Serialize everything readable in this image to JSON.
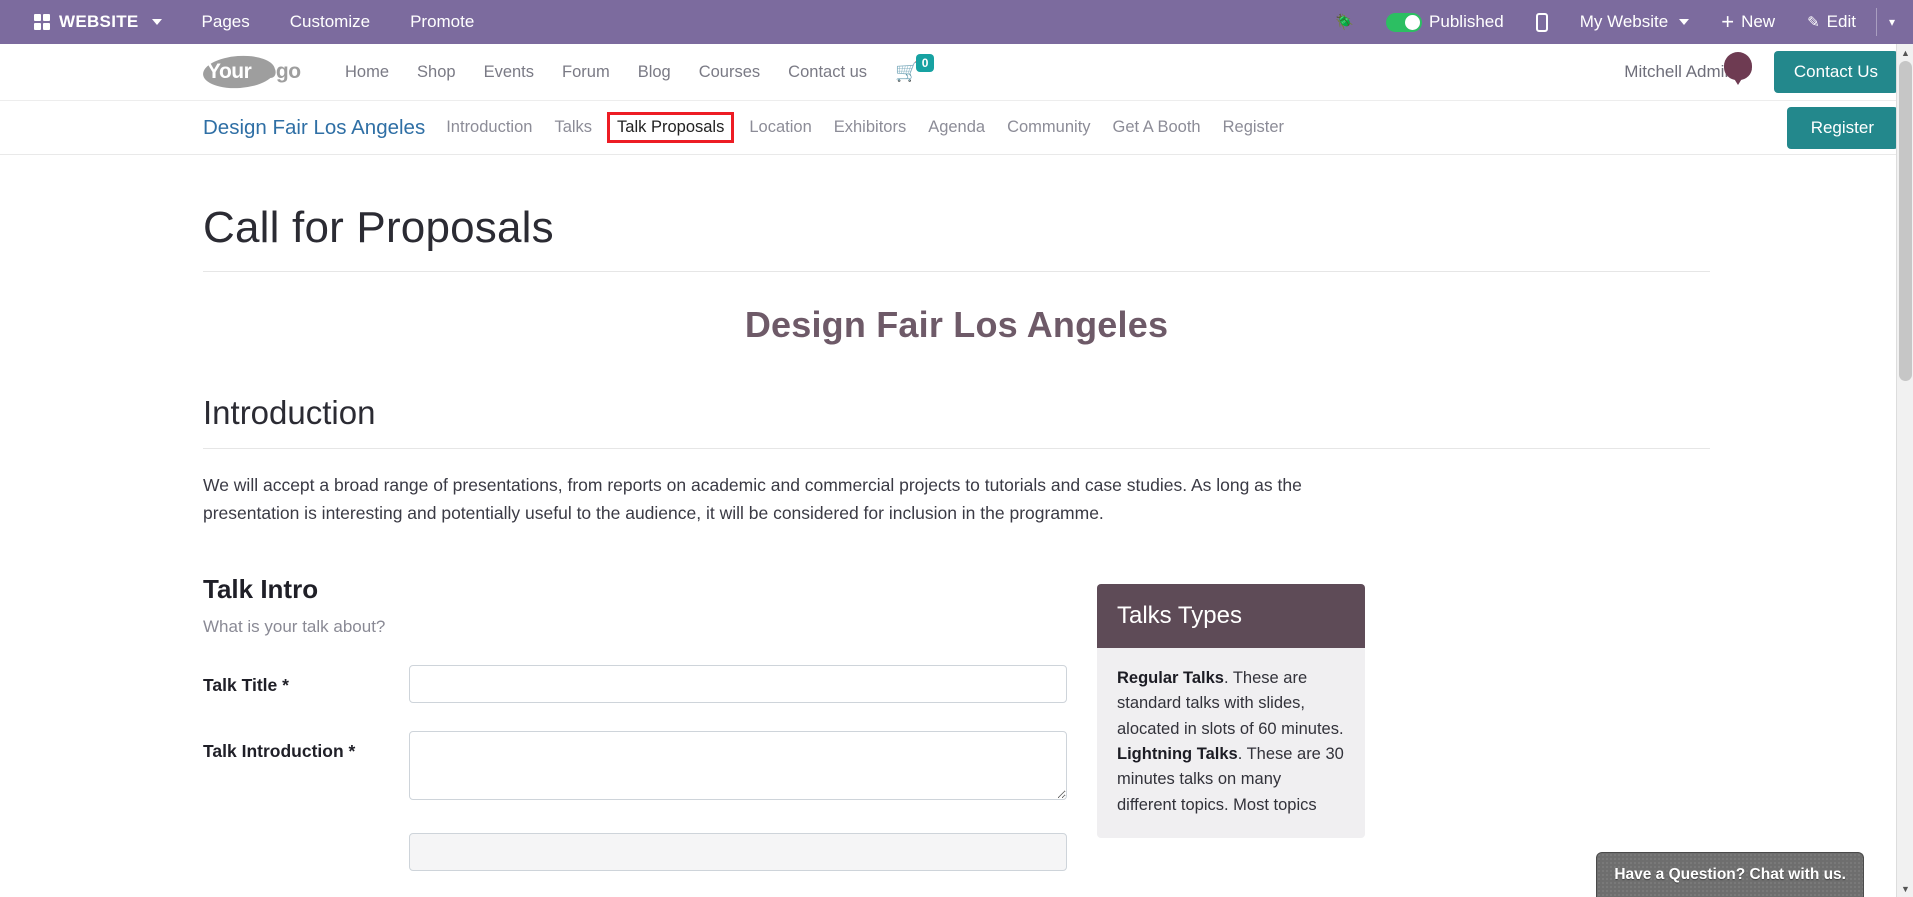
{
  "editor_bar": {
    "apps_label": "WEBSITE",
    "items": [
      {
        "label": "Pages"
      },
      {
        "label": "Customize"
      },
      {
        "label": "Promote"
      }
    ],
    "bug_icon": "bug-icon",
    "published_label": "Published",
    "published_state": "on",
    "mobile_icon": "mobile-preview-icon",
    "my_website_label": "My Website",
    "new_label": "New",
    "edit_label": "Edit",
    "accent_color": "#7C6B9E",
    "toggle_on_color": "#2CBF62"
  },
  "site_header": {
    "logo": {
      "first": "Your",
      "second": "Logo"
    },
    "nav": [
      {
        "label": "Home"
      },
      {
        "label": "Shop"
      },
      {
        "label": "Events"
      },
      {
        "label": "Forum"
      },
      {
        "label": "Blog"
      },
      {
        "label": "Courses"
      },
      {
        "label": "Contact us"
      }
    ],
    "cart_count": "0",
    "cart_badge_color": "#17A2A2",
    "user_name": "Mitchell Admin",
    "contact_button": "Contact Us",
    "button_color": "#23888C"
  },
  "event_nav": {
    "event_title": "Design Fair Los Angeles",
    "links": [
      {
        "label": "Introduction",
        "active": false
      },
      {
        "label": "Talks",
        "active": false
      },
      {
        "label": "Talk Proposals",
        "active": true
      },
      {
        "label": "Location",
        "active": false
      },
      {
        "label": "Exhibitors",
        "active": false
      },
      {
        "label": "Agenda",
        "active": false
      },
      {
        "label": "Community",
        "active": false
      },
      {
        "label": "Get A Booth",
        "active": false
      },
      {
        "label": "Register",
        "active": false
      }
    ],
    "register_button": "Register",
    "highlight_color": "#ED1C24",
    "title_color": "#2F6FA5"
  },
  "content": {
    "page_title": "Call for Proposals",
    "event_heading": "Design Fair Los Angeles",
    "event_heading_color": "#6E5A68",
    "section_heading": "Introduction",
    "intro_text": "We will accept a broad range of presentations, from reports on academic and commercial projects to tutorials and case studies. As long as the presentation is interesting and potentially useful to the audience, it will be considered for inclusion in the programme.",
    "form": {
      "heading": "Talk Intro",
      "subtitle": "What is your talk about?",
      "fields": [
        {
          "label": "Talk Title *",
          "type": "text",
          "value": ""
        },
        {
          "label": "Talk Introduction *",
          "type": "textarea",
          "value": ""
        }
      ]
    },
    "sidebar_card": {
      "title": "Talks Types",
      "header_color": "#5E4B57",
      "body_color": "#F0EFF1",
      "items": [
        {
          "term": "Regular Talks",
          "text": ". These are standard talks with slides, alocated in slots of 60 minutes."
        },
        {
          "term": "Lightning Talks",
          "text": ". These are 30 minutes talks on many different topics. Most topics"
        }
      ]
    }
  },
  "chat_widget": {
    "label": "Have a Question? Chat with us."
  },
  "balloon_marker": {
    "color": "#6E3B52"
  }
}
